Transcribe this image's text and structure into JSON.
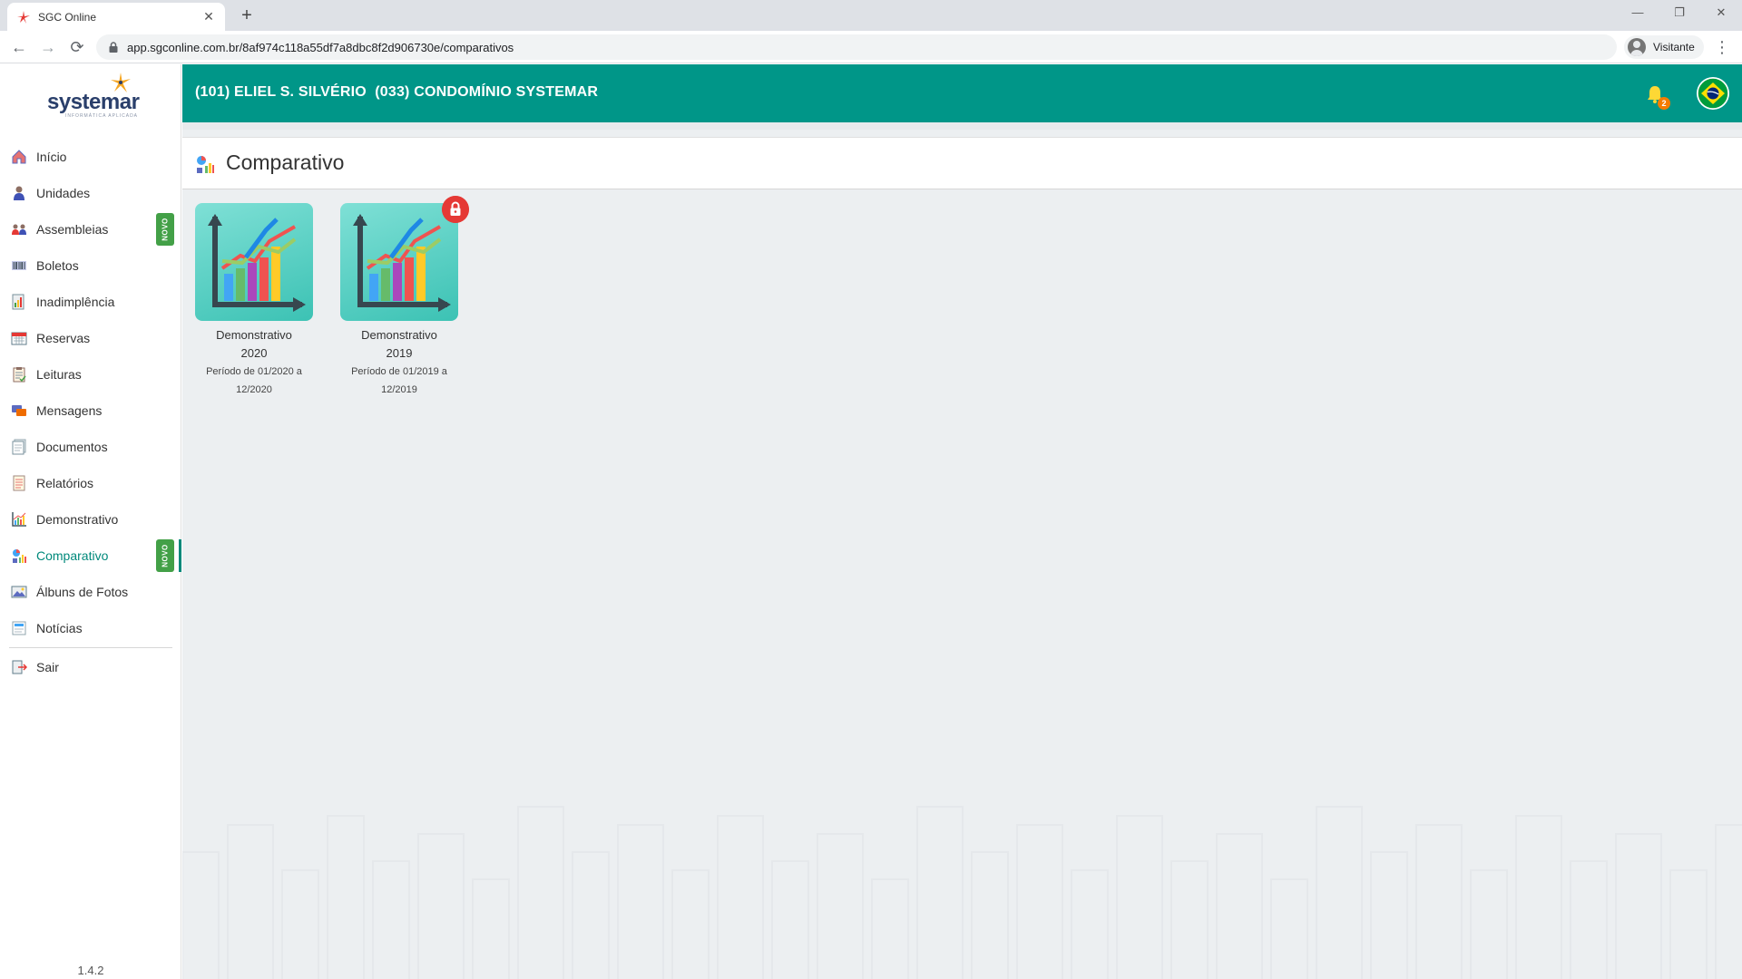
{
  "browser": {
    "tab_title": "SGC Online",
    "tab_close": "✕",
    "new_tab": "+",
    "url": "app.sgconline.com.br/8af974c118a55df7a8dbc8f2d906730e/comparativos",
    "profile_label": "Visitante",
    "menu_icon": "⋮",
    "window_controls": [
      "—",
      "❐",
      "✕"
    ],
    "nav": {
      "back": "←",
      "forward": "→",
      "reload": "⟳"
    }
  },
  "brand": {
    "logo_text": "systemar",
    "logo_tagline": "INFORMÁTICA APLICADA",
    "accent": "#009688",
    "active": "#00897b",
    "badge": "#43a047"
  },
  "sidebar": {
    "items": [
      {
        "label": "Início",
        "icon": "home-icon"
      },
      {
        "label": "Unidades",
        "icon": "person-icon"
      },
      {
        "label": "Assembleias",
        "icon": "people-icon",
        "badge": "NOVO"
      },
      {
        "label": "Boletos",
        "icon": "barcode-icon"
      },
      {
        "label": "Inadimplência",
        "icon": "debt-report-icon"
      },
      {
        "label": "Reservas",
        "icon": "calendar-icon"
      },
      {
        "label": "Leituras",
        "icon": "clipboard-icon"
      },
      {
        "label": "Mensagens",
        "icon": "chat-icon"
      },
      {
        "label": "Documentos",
        "icon": "documents-icon"
      },
      {
        "label": "Relatórios",
        "icon": "report-icon"
      },
      {
        "label": "Demonstrativo",
        "icon": "chart-icon"
      },
      {
        "label": "Comparativo",
        "icon": "compare-chart-icon",
        "badge": "NOVO",
        "active": true
      },
      {
        "label": "Álbuns de Fotos",
        "icon": "photo-album-icon"
      },
      {
        "label": "Notícias",
        "icon": "news-icon"
      }
    ],
    "logout_label": "Sair",
    "version": "1.4.2"
  },
  "header": {
    "title": "(101) ELIEL S. SILVÉRIO  (033) CONDOMÍNIO SYSTEMAR",
    "notification_count": "2"
  },
  "page": {
    "title": "Comparativo"
  },
  "cards": [
    {
      "title": "Demonstrativo 2020",
      "subtitle": "Período de 01/2020 a 12/2020",
      "locked": false
    },
    {
      "title": "Demonstrativo 2019",
      "subtitle": "Período de 01/2019 a 12/2019",
      "locked": true
    }
  ]
}
